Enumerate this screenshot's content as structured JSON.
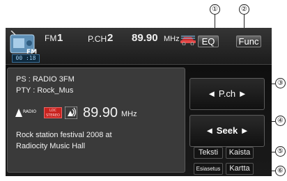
{
  "callouts": [
    "①",
    "②",
    "③",
    "④",
    "⑤",
    "⑥"
  ],
  "header": {
    "source_icon_label": "FM",
    "clock": "00 :18",
    "band_label": "FM",
    "band_number": "1",
    "preset_label": "P.CH",
    "preset_number": "2",
    "frequency": "89.90",
    "frequency_unit": "MHz",
    "eq_button": "EQ",
    "func_button": "Func"
  },
  "info": {
    "ps_line": "PS   : RADIO 3FM",
    "pty_line": "PTY : Rock_Mus",
    "radio_logo_text": "RADIO",
    "stereo_badge": [
      "LOC",
      "STEREO"
    ],
    "frequency": "89.90",
    "frequency_unit": "MHz",
    "radio_text_line1": "Rock station festival 2008 at",
    "radio_text_line2": "Radiocity Music Hall"
  },
  "controls": {
    "pch_button": "◄  P.ch  ►",
    "seek_button": "◄  Seek  ►",
    "teksti_button": "Teksti",
    "kaista_button": "Kaista",
    "esiasetus_button": "Esiasetus",
    "kartta_button": "Kartta"
  },
  "icons": [
    "fm-radio-icon",
    "traffic-car-icon",
    "radio-logo-icon",
    "signal-icon"
  ],
  "colors": {
    "screen_bg": "#111111",
    "panel_bg": "#3a3a3a",
    "stereo_red": "#c8231f",
    "clock_blue": "#3a6f99"
  }
}
